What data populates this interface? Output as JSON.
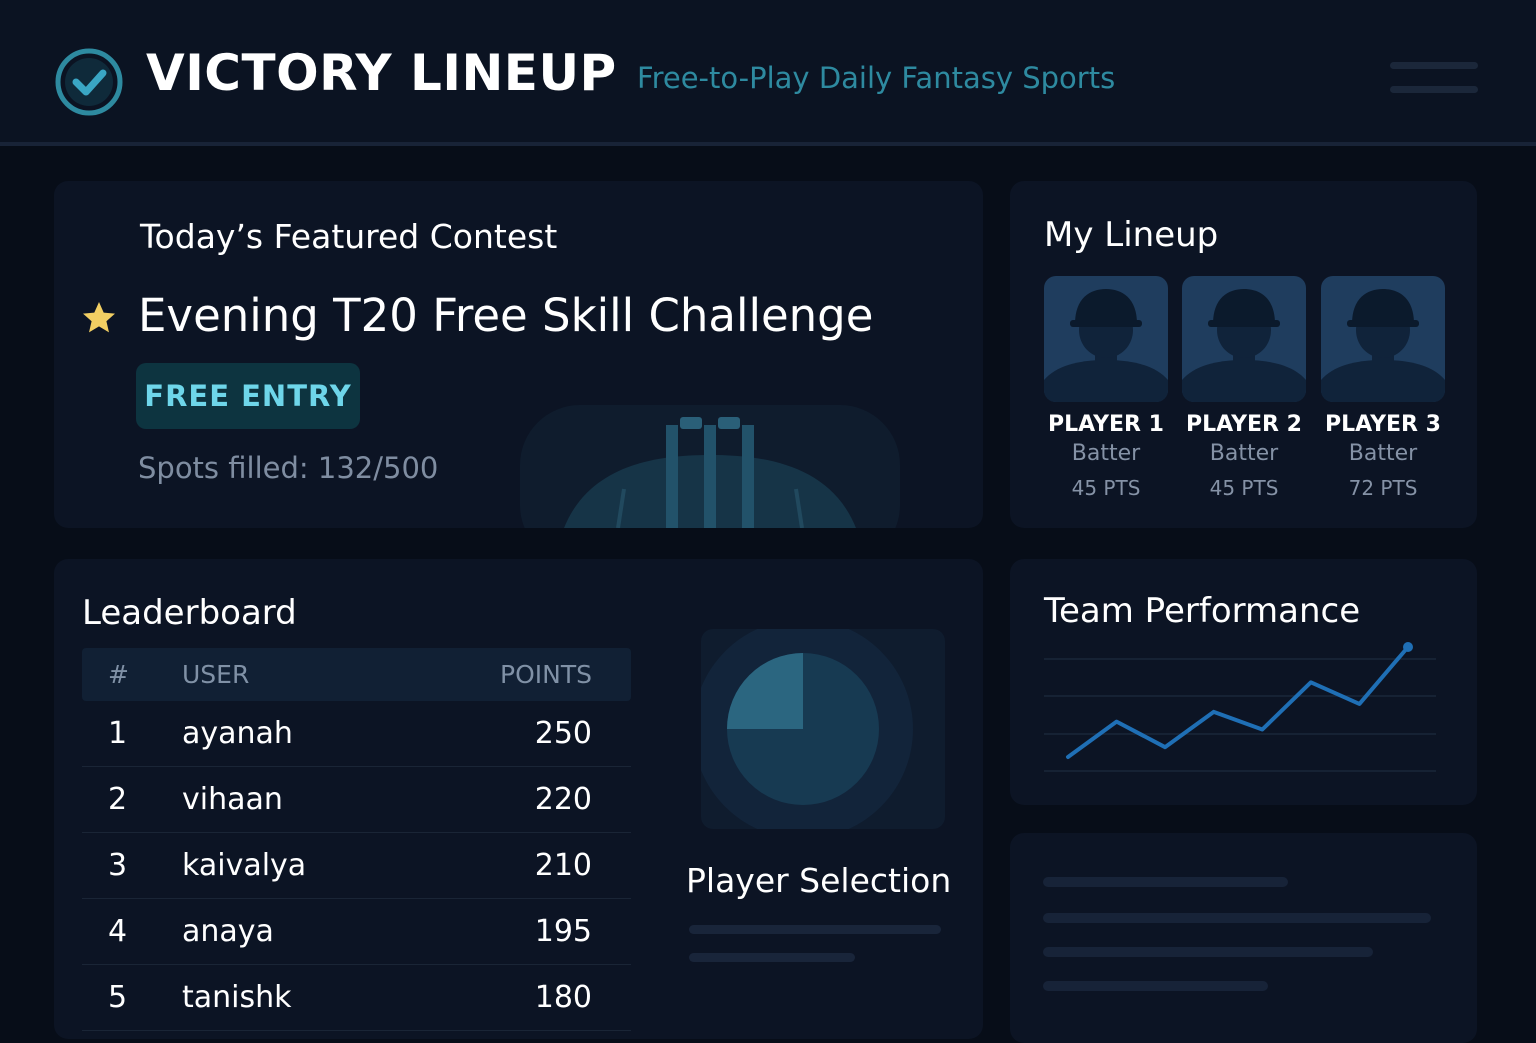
{
  "app": {
    "brand": "VICTORY LINEUP",
    "tagline": "Free-to-Play Daily Fantasy Sports",
    "logo_icon": "check-circle-icon",
    "menu_icon": "hamburger-menu-icon"
  },
  "colors": {
    "background": "#070d18",
    "card": "#0c1424",
    "accent": "#2e8aa0",
    "badge_text": "#6ed6ea",
    "star": "#f2cf63",
    "line": "#1f6fb5"
  },
  "featured": {
    "label": "Today’s Featured Contest",
    "contest_name": "Evening T20 Free Skill Challenge",
    "badge": "FREE ENTRY",
    "spots": "Spots filled: 132/500",
    "star_icon": "star-icon"
  },
  "lineup": {
    "title": "My Lineup",
    "players": [
      {
        "name": "PLAYER 1",
        "role": "Batter",
        "points": "45 PTS"
      },
      {
        "name": "PLAYER 2",
        "role": "Batter",
        "points": "45 PTS"
      },
      {
        "name": "PLAYER 3",
        "role": "Batter",
        "points": "72 PTS"
      }
    ]
  },
  "leaderboard": {
    "title": "Leaderboard",
    "columns": [
      "#",
      "USER",
      "POINTS"
    ],
    "rows": [
      {
        "rank": "1",
        "user": "ayanah",
        "points": "250"
      },
      {
        "rank": "2",
        "user": "vihaan",
        "points": "220"
      },
      {
        "rank": "3",
        "user": "kaivalya",
        "points": "210"
      },
      {
        "rank": "4",
        "user": "anaya",
        "points": "195"
      },
      {
        "rank": "5",
        "user": "tanishk",
        "points": "180"
      }
    ]
  },
  "player_selection": {
    "title": "Player Selection",
    "selected_fraction": 0.25
  },
  "performance": {
    "title": "Team Performance",
    "values": [
      0,
      18,
      5,
      23,
      14,
      38,
      27,
      56
    ]
  }
}
